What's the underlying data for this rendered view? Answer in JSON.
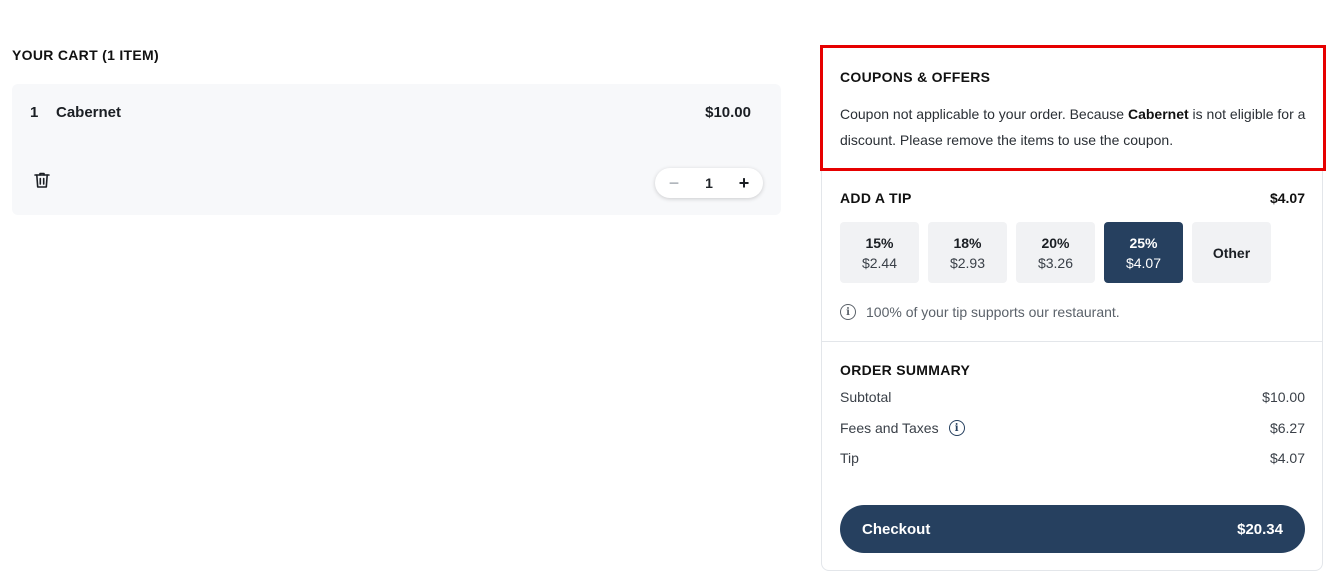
{
  "cart": {
    "title": "YOUR CART (1 ITEM)",
    "items": [
      {
        "qty": "1",
        "name": "Cabernet",
        "price": "$10.00",
        "stepper_value": "1"
      }
    ]
  },
  "coupons": {
    "title": "COUPONS & OFFERS",
    "message_before": "Coupon not applicable to your order. Because ",
    "message_item": "Cabernet",
    "message_after": " is not eligible for a discount. Please remove the items to use the coupon."
  },
  "tip": {
    "title": "ADD A TIP",
    "amount": "$4.07",
    "options": [
      {
        "pct": "15%",
        "amt": "$2.44"
      },
      {
        "pct": "18%",
        "amt": "$2.93"
      },
      {
        "pct": "20%",
        "amt": "$3.26"
      },
      {
        "pct": "25%",
        "amt": "$4.07"
      },
      {
        "pct": "Other",
        "amt": ""
      }
    ],
    "selected": "25%",
    "note": "100% of your tip supports our restaurant."
  },
  "summary": {
    "title": "ORDER SUMMARY",
    "subtotal_label": "Subtotal",
    "subtotal_value": "$10.00",
    "fees_label": "Fees and Taxes",
    "fees_value": "$6.27",
    "tip_label": "Tip",
    "tip_value": "$4.07"
  },
  "checkout": {
    "label": "Checkout",
    "total": "$20.34"
  },
  "colors": {
    "accent": "#26405f",
    "highlight_border": "#e60000"
  },
  "icons": {
    "trash": "trash-icon",
    "info": "info-icon",
    "minus": "minus-icon",
    "plus": "plus-icon"
  }
}
